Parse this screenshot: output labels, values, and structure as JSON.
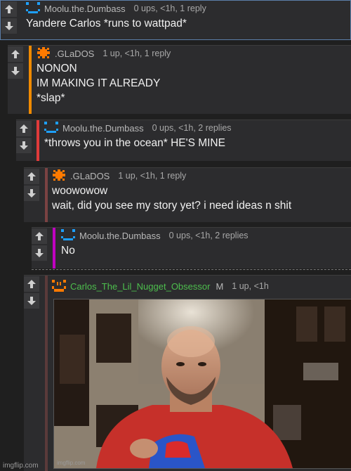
{
  "comments": [
    {
      "user": "Moolu.the.Dumbass",
      "meta": "0 ups, <1h, 1 reply",
      "text": "Yandere Carlos *runs to wattpad*",
      "bar": "",
      "avatar": "face-blue-icon"
    },
    {
      "user": ".GLaDOS",
      "meta": "1 up, <1h, 1 reply",
      "text": "NONON\nIM MAKING IT ALREADY\n*slap*",
      "bar": "#f08a00",
      "avatar": "virus-orange-icon"
    },
    {
      "user": "Moolu.the.Dumbass",
      "meta": "0 ups, <1h, 2 replies",
      "text": "*throws you in the ocean* HE'S MINE",
      "bar": "#e03a3a",
      "avatar": "face-blue-icon"
    },
    {
      "user": ".GLaDOS",
      "meta": "1 up, <1h, 1 reply",
      "text": "woowowow\nwait, did you see my story yet? i need ideas n shit",
      "bar": "#7a4242",
      "avatar": "virus-orange-icon"
    },
    {
      "user": "Moolu.the.Dumbass",
      "meta": "0 ups, <1h, 2 replies",
      "text": "No",
      "bar": "#c000c0",
      "avatar": "face-blue-icon"
    },
    {
      "user": "Carlos_The_Lil_Nugget_Obsessor",
      "mod": "M",
      "meta": "1 up, <1h",
      "bar": "#5a3a3a",
      "avatar": "face-orange-icon",
      "image_caption": "imgflip.com"
    }
  ],
  "watermark": "imgflip.com",
  "colors": {
    "accent_blue": "#1ea0ff",
    "accent_orange": "#ff7a00",
    "username_green": "#4dbe4d"
  }
}
